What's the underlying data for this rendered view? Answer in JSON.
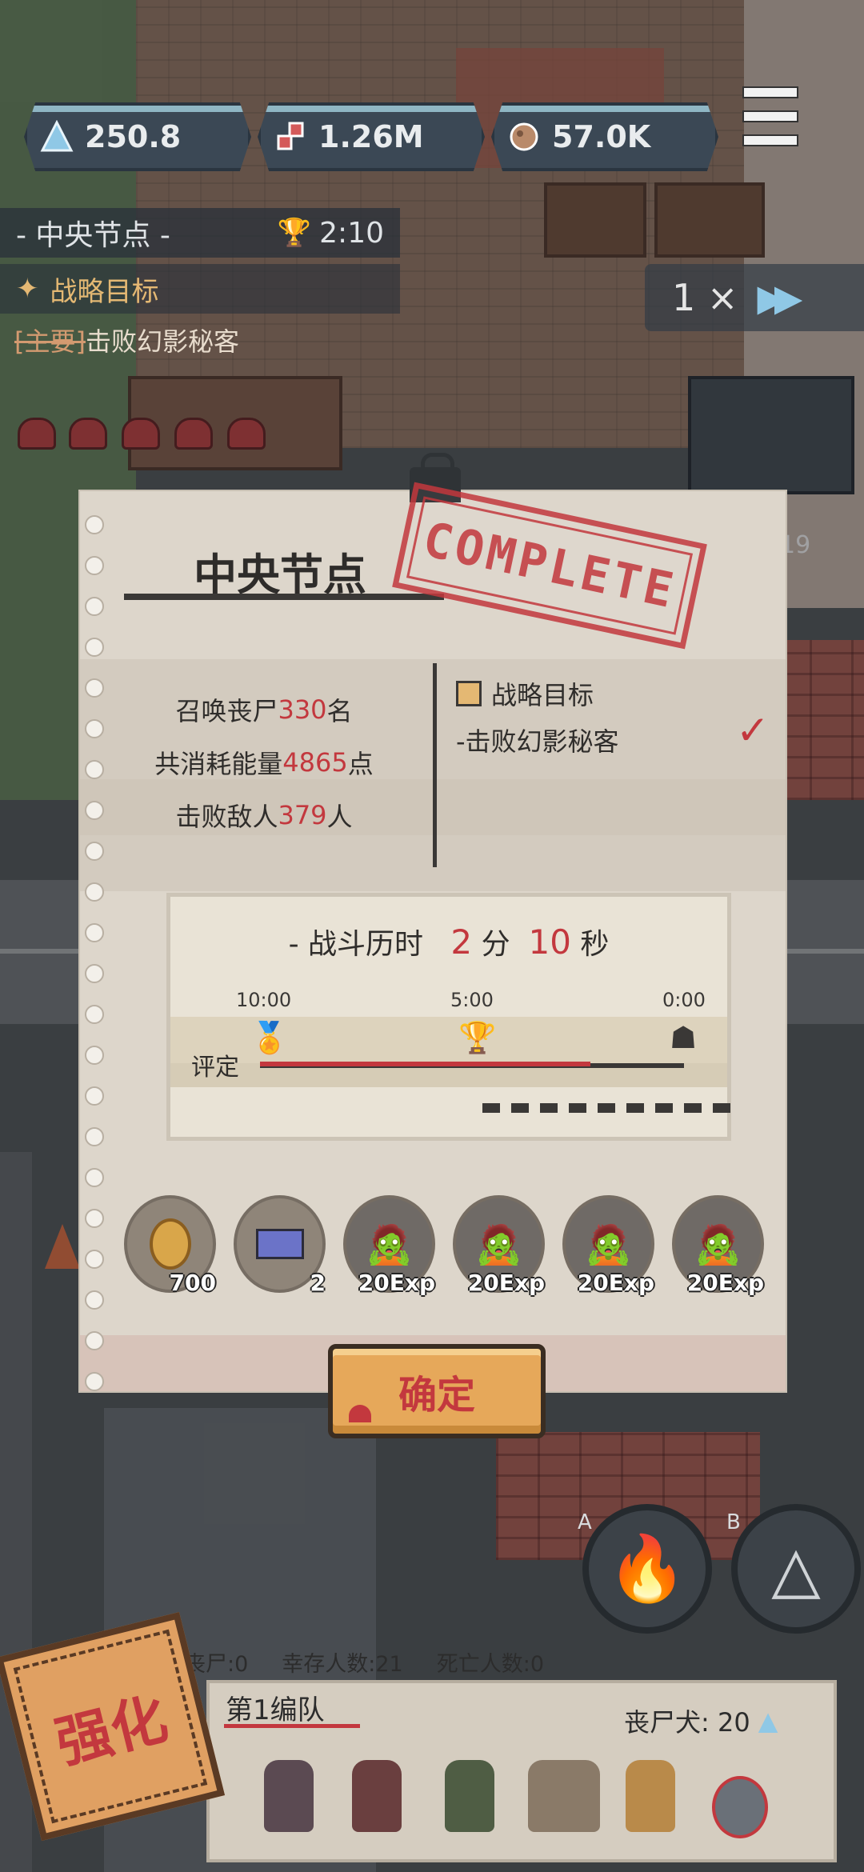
{
  "hud": {
    "resources": [
      {
        "icon": "triangle-crystal-icon",
        "value": "250.8"
      },
      {
        "icon": "blood-drops-icon",
        "value": "1.26M"
      },
      {
        "icon": "ore-icon",
        "value": "57.0K"
      }
    ],
    "menu_icon": "hamburger-menu-icon"
  },
  "level": {
    "name": "- 中央节点 -",
    "timer": "2:10",
    "goal_title": "战略目标",
    "goal_tag": "[主要]",
    "goal_text": "击败幻影秘客"
  },
  "speed": {
    "label": "1 ×"
  },
  "side_badge": "19",
  "modal": {
    "title": "中央节点",
    "stamp": "COMPLETE",
    "stats": [
      {
        "label": "召唤丧尸",
        "value": "330",
        "unit": "名"
      },
      {
        "label": "共消耗能量",
        "value": "4865",
        "unit": "点"
      },
      {
        "label": "击败敌人",
        "value": "379",
        "unit": "人"
      }
    ],
    "objective_title": "战略目标",
    "objective_desc": "-击败幻影秘客",
    "battle": {
      "prefix": "- 战斗历时",
      "minutes": "2",
      "min_unit": "分",
      "seconds": "10",
      "sec_unit": "秒"
    },
    "timeline": {
      "rating_label": "评定",
      "ticks": [
        "10:00",
        "5:00",
        "0:00"
      ],
      "progress": 0.78
    },
    "rewards": [
      {
        "icon": "coin-icon",
        "qty": "700"
      },
      {
        "icon": "card-icon",
        "qty": "2"
      },
      {
        "icon": "zombie-portrait-icon",
        "qty": "20Exp"
      },
      {
        "icon": "zombie-portrait-icon",
        "qty": "20Exp"
      },
      {
        "icon": "zombie-portrait-icon",
        "qty": "20Exp"
      },
      {
        "icon": "zombie-portrait-icon",
        "qty": "20Exp"
      }
    ],
    "confirm_label": "确定"
  },
  "skills": [
    {
      "key": "A",
      "icon": "fire-summon-icon"
    },
    {
      "key": "B",
      "icon": "pyramid-icon"
    }
  ],
  "status": {
    "zombies": "丧尸:0",
    "survivors": "幸存人数:21",
    "dead": "死亡人数:0"
  },
  "team": {
    "name": "第1编队",
    "dog_label": "丧尸犬: 20"
  },
  "enhance_label": "强化",
  "colors": {
    "accent_red": "#c3383e",
    "paper": "#ddd6cb",
    "button": "#e6a85a"
  }
}
